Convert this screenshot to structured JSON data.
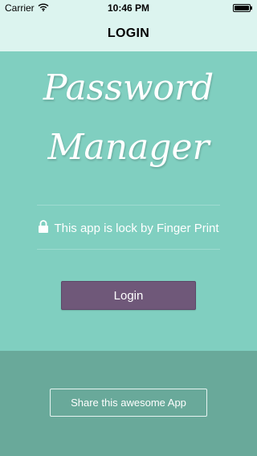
{
  "status_bar": {
    "carrier": "Carrier",
    "time": "10:46 PM",
    "icons": [
      "wifi-icon",
      "battery-icon"
    ]
  },
  "nav": {
    "title": "LOGIN"
  },
  "hero": {
    "title_line1": "Password",
    "title_line2": "Manager",
    "lock_message": "This app is lock by Finger Print",
    "login_label": "Login"
  },
  "footer": {
    "share_label": "Share this awesome App"
  },
  "colors": {
    "background": "#80cfc0",
    "header": "#dcf4ef",
    "footer": "#69a99a",
    "login_button": "#6f5879"
  }
}
